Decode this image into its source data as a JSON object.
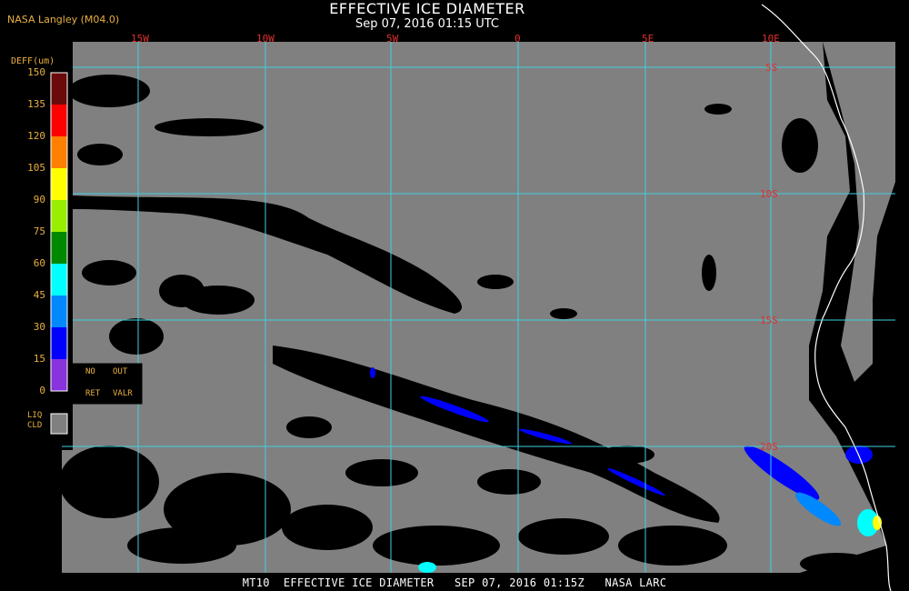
{
  "header": {
    "title": "EFFECTIVE ICE DIAMETER",
    "subtitle": "Sep 07, 2016 01:15 UTC",
    "agency": "NASA Langley (M04.0)"
  },
  "legend": {
    "title": "DEFF(um)",
    "ticks": [
      "150",
      "135",
      "120",
      "105",
      "90",
      "75",
      "60",
      "45",
      "30",
      "15",
      "0"
    ],
    "colors": [
      "#6b0a0a",
      "#ff0000",
      "#ff8000",
      "#ffff00",
      "#99ee00",
      "#008800",
      "#00ffff",
      "#0088ff",
      "#0000ff",
      "#8833dd"
    ],
    "no_ret": "NO RET",
    "out_valr": "OUT VALR",
    "liq_cld": "LIQ CLD",
    "no_label_1": "NO",
    "no_label_2": "RET",
    "out_label_1": "OUT",
    "out_label_2": "VALR",
    "liq_label_1": "LIQ",
    "liq_label_2": "CLD"
  },
  "grid": {
    "longitudes": [
      "15W",
      "10W",
      "5W",
      "0",
      "5E",
      "10E"
    ],
    "latitudes": [
      "5S",
      "10S",
      "15S",
      "20S"
    ],
    "grid_color": "#40d0e0",
    "label_color": "#e03030"
  },
  "footer": {
    "text": "MT10  EFFECTIVE ICE DIAMETER   SEP 07, 2016 01:15Z   NASA LARC"
  },
  "colors": {
    "land_cloud_gray": "#808080",
    "background": "#000000",
    "coastline": "#ffffff"
  }
}
